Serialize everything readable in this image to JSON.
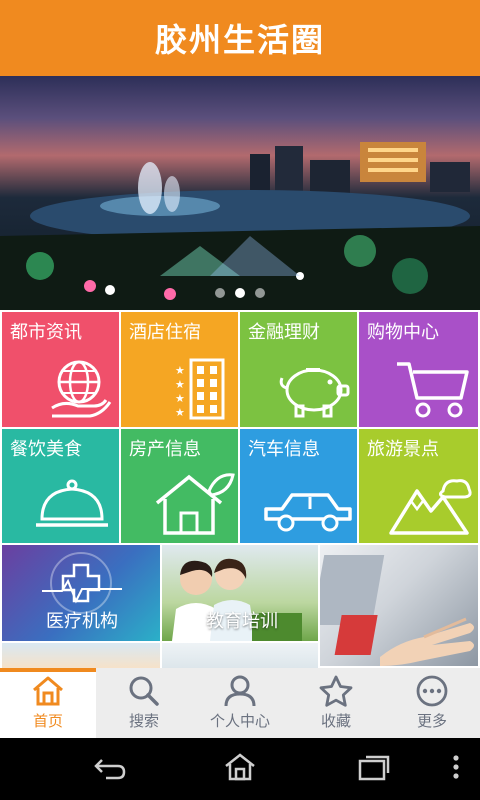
{
  "header": {
    "title": "胶州生活圈"
  },
  "banner": {
    "slides": 3,
    "active_slide": 2
  },
  "categories": [
    {
      "label": "都市资讯",
      "color": "#f0506b",
      "icon": "globe-hand-icon"
    },
    {
      "label": "酒店住宿",
      "color": "#f5a623",
      "icon": "hotel-building-icon"
    },
    {
      "label": "金融理财",
      "color": "#7cc241",
      "icon": "piggy-bank-icon"
    },
    {
      "label": "购物中心",
      "color": "#a950c8",
      "icon": "shopping-cart-icon"
    },
    {
      "label": "餐饮美食",
      "color": "#29b9a2",
      "icon": "food-cloche-icon"
    },
    {
      "label": "房产信息",
      "color": "#43bb63",
      "icon": "house-icon"
    },
    {
      "label": "汽车信息",
      "color": "#2e9de0",
      "icon": "car-icon"
    },
    {
      "label": "旅游景点",
      "color": "#a8cc2c",
      "icon": "mountain-icon"
    }
  ],
  "promos": {
    "medical": "医疗机构",
    "education": "教育培训"
  },
  "tabs": [
    {
      "label": "首页",
      "icon": "home-icon",
      "active": true
    },
    {
      "label": "搜索",
      "icon": "search-icon",
      "active": false
    },
    {
      "label": "个人中心",
      "icon": "user-icon",
      "active": false
    },
    {
      "label": "收藏",
      "icon": "star-icon",
      "active": false
    },
    {
      "label": "更多",
      "icon": "more-icon",
      "active": false
    }
  ]
}
